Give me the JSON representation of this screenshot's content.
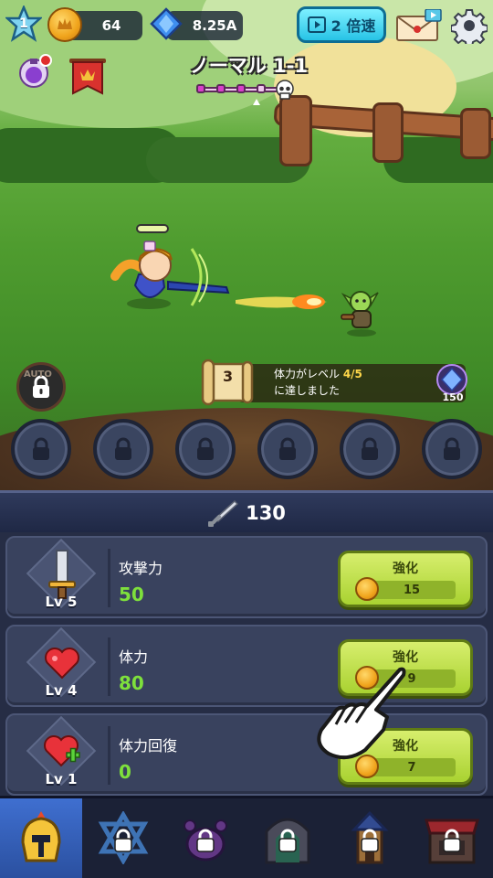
{
  "hud": {
    "player_level": "1",
    "coins": "64",
    "gems": "8.25A",
    "speed_label": "2 倍速"
  },
  "stage": {
    "title": "ノーマル 1-1",
    "progress_wave": 1,
    "progress_total": 4
  },
  "battle": {
    "auto_label": "AUTO",
    "quest": {
      "number": "3",
      "text_prefix": "体力がレベル ",
      "text_progress": "4/5",
      "text_suffix": "に達しました",
      "reward": "150"
    },
    "skill_slots": 6
  },
  "attack_total": "130",
  "upgrades": [
    {
      "name": "攻撃力",
      "level": "Lv 5",
      "value": "50",
      "button": "強化",
      "cost": "15",
      "icon": "sword-icon"
    },
    {
      "name": "体力",
      "level": "Lv 4",
      "value": "80",
      "button": "強化",
      "cost": "9",
      "icon": "heart-icon"
    },
    {
      "name": "体力回復",
      "level": "Lv 1",
      "value": "0",
      "button": "強化",
      "cost": "7",
      "icon": "heart-plus-icon"
    }
  ],
  "nav": [
    {
      "name": "hero",
      "icon": "helmet-icon",
      "locked": false,
      "active": true
    },
    {
      "name": "star",
      "icon": "star-icon",
      "locked": true,
      "active": false
    },
    {
      "name": "pet",
      "icon": "paw-icon",
      "locked": true,
      "active": false
    },
    {
      "name": "dungeon",
      "icon": "gate-icon",
      "locked": true,
      "active": false
    },
    {
      "name": "tower",
      "icon": "tower-icon",
      "locked": true,
      "active": false
    },
    {
      "name": "shop",
      "icon": "shop-icon",
      "locked": true,
      "active": false
    }
  ],
  "colors": {
    "accent_green": "#7ee03c",
    "button_green": "#a9d231",
    "speed_cyan": "#27c3e6",
    "panel_bg": "#262d45"
  }
}
